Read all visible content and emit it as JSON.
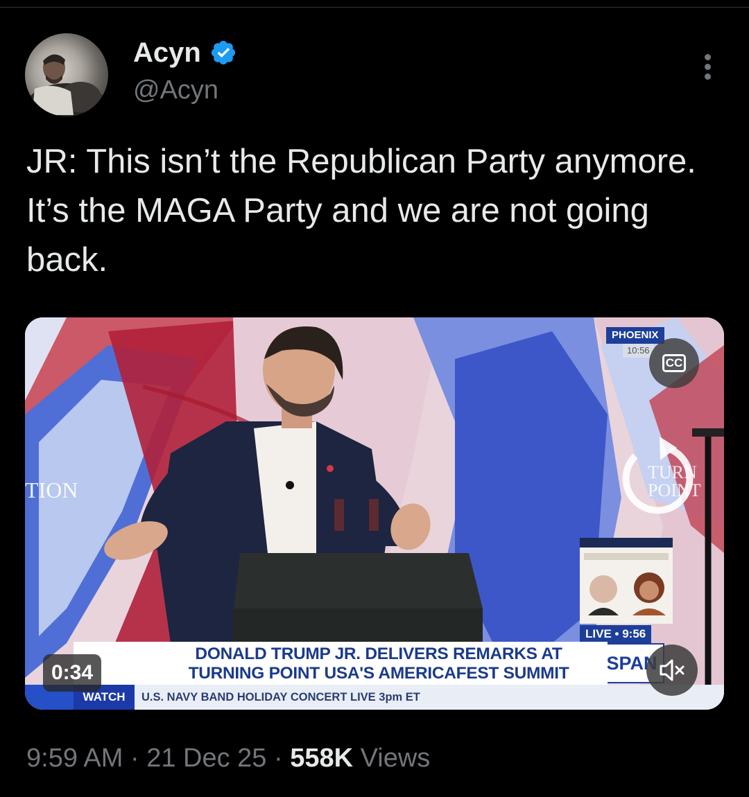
{
  "author": {
    "display_name": "Acyn",
    "handle": "@Acyn",
    "verified": true
  },
  "tweet": {
    "text": "JR: This isn’t the Republican Party anymore. It’s the MAGA Party and we are not going back."
  },
  "media": {
    "duration": "0:34",
    "cc_label": "CC",
    "lower_third": {
      "headline_line1": "DONALD TRUMP JR. DELIVERS REMARKS AT",
      "headline_line2": "TURNING POINT USA'S AMERICAFEST SUMMIT",
      "ticker_tag": "WATCH",
      "ticker_text": "U.S. NAVY BAND HOLIDAY CONCERT  LIVE 3pm ET",
      "live_label": "LIVE",
      "live_time": "9:56",
      "network": "C-SPAN",
      "location": "PHOENIX",
      "location_time": "10:56"
    },
    "backdrop_text_left": "TION",
    "backdrop_text_right_1": "TURN",
    "backdrop_text_right_2": "POINT"
  },
  "meta": {
    "time": "9:59 AM",
    "separator": " · ",
    "date": "21 Dec 25",
    "views_count": "558K",
    "views_label": "Views"
  },
  "colors": {
    "background": "#000000",
    "text_primary": "#e7e9ea",
    "text_secondary": "#71767b",
    "verified_badge": "#1d9bf0"
  },
  "icons": [
    "verified-badge-icon",
    "more-options-icon",
    "closed-captions-icon",
    "mute-icon"
  ]
}
